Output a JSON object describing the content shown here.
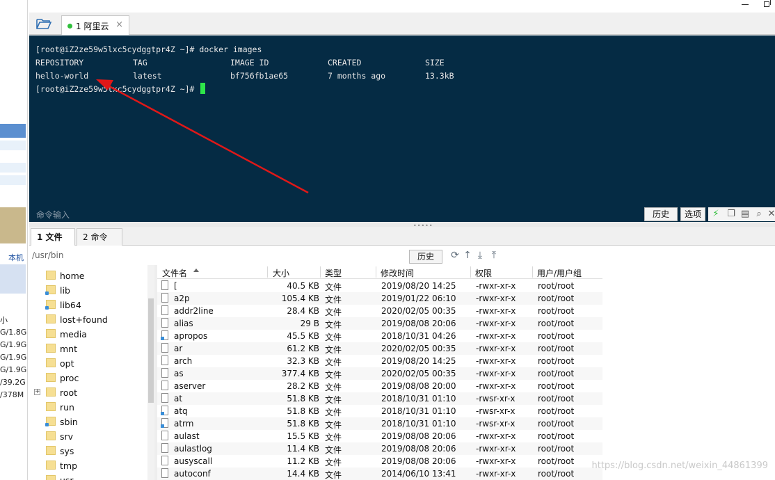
{
  "terminal": {
    "tab_label": "1 阿里云",
    "tab_close": "×",
    "prompt1": "[root@iZ2ze59w5lxc5cydggtpr4Z ~]# docker images",
    "headers": [
      "REPOSITORY",
      "TAG",
      "IMAGE ID",
      "CREATED",
      "SIZE"
    ],
    "row": [
      "hello-world",
      "latest",
      "bf756fb1ae65",
      "7 months ago",
      "13.3kB"
    ],
    "prompt2": "[root@iZ2ze59w5lxc5cydggtpr4Z ~]#",
    "cmd_input_placeholder": "命令输入",
    "history_btn": "历史",
    "options_btn": "选项",
    "cursor_color": "#2ee64a",
    "arrow_color": "#e01818"
  },
  "left_sliver": {
    "local_label": "本机",
    "texts": [
      "小",
      "G/1.8G",
      "G/1.9G",
      "G/1.9G",
      "G/1.9G",
      "/39.2G",
      "/378M"
    ]
  },
  "bottom_tabs": {
    "files": "1 文件",
    "commands": "2 命令"
  },
  "path": {
    "value": "/usr/bin",
    "history_btn": "历史"
  },
  "tree": {
    "items": [
      {
        "label": "home",
        "link": false,
        "expander": ""
      },
      {
        "label": "lib",
        "link": true,
        "expander": ""
      },
      {
        "label": "lib64",
        "link": true,
        "expander": ""
      },
      {
        "label": "lost+found",
        "link": false,
        "expander": ""
      },
      {
        "label": "media",
        "link": false,
        "expander": ""
      },
      {
        "label": "mnt",
        "link": false,
        "expander": ""
      },
      {
        "label": "opt",
        "link": false,
        "expander": ""
      },
      {
        "label": "proc",
        "link": false,
        "expander": ""
      },
      {
        "label": "root",
        "link": false,
        "expander": "+"
      },
      {
        "label": "run",
        "link": false,
        "expander": ""
      },
      {
        "label": "sbin",
        "link": true,
        "expander": ""
      },
      {
        "label": "srv",
        "link": false,
        "expander": ""
      },
      {
        "label": "sys",
        "link": false,
        "expander": ""
      },
      {
        "label": "tmp",
        "link": false,
        "expander": ""
      },
      {
        "label": "usr",
        "link": false,
        "expander": ""
      }
    ]
  },
  "files": {
    "headers": [
      "文件名",
      "大小",
      "类型",
      "修改时间",
      "权限",
      "用户/用户组"
    ],
    "rows": [
      [
        "[",
        "40.5 KB",
        "文件",
        "2019/08/20 14:25",
        "-rwxr-xr-x",
        "root/root",
        false
      ],
      [
        "a2p",
        "105.4 KB",
        "文件",
        "2019/01/22 06:10",
        "-rwxr-xr-x",
        "root/root",
        false
      ],
      [
        "addr2line",
        "28.4 KB",
        "文件",
        "2020/02/05 00:35",
        "-rwxr-xr-x",
        "root/root",
        false
      ],
      [
        "alias",
        "29 B",
        "文件",
        "2019/08/08 20:06",
        "-rwxr-xr-x",
        "root/root",
        false
      ],
      [
        "apropos",
        "45.5 KB",
        "文件",
        "2018/10/31 04:26",
        "-rwxr-xr-x",
        "root/root",
        true
      ],
      [
        "ar",
        "61.2 KB",
        "文件",
        "2020/02/05 00:35",
        "-rwxr-xr-x",
        "root/root",
        false
      ],
      [
        "arch",
        "32.3 KB",
        "文件",
        "2019/08/20 14:25",
        "-rwxr-xr-x",
        "root/root",
        false
      ],
      [
        "as",
        "377.4 KB",
        "文件",
        "2020/02/05 00:35",
        "-rwxr-xr-x",
        "root/root",
        false
      ],
      [
        "aserver",
        "28.2 KB",
        "文件",
        "2019/08/08 20:00",
        "-rwxr-xr-x",
        "root/root",
        false
      ],
      [
        "at",
        "51.8 KB",
        "文件",
        "2018/10/31 01:10",
        "-rwsr-xr-x",
        "root/root",
        false
      ],
      [
        "atq",
        "51.8 KB",
        "文件",
        "2018/10/31 01:10",
        "-rwsr-xr-x",
        "root/root",
        true
      ],
      [
        "atrm",
        "51.8 KB",
        "文件",
        "2018/10/31 01:10",
        "-rwsr-xr-x",
        "root/root",
        true
      ],
      [
        "aulast",
        "15.5 KB",
        "文件",
        "2019/08/08 20:06",
        "-rwxr-xr-x",
        "root/root",
        false
      ],
      [
        "aulastlog",
        "11.4 KB",
        "文件",
        "2019/08/08 20:06",
        "-rwxr-xr-x",
        "root/root",
        false
      ],
      [
        "ausyscall",
        "11.2 KB",
        "文件",
        "2019/08/08 20:06",
        "-rwxr-xr-x",
        "root/root",
        false
      ],
      [
        "autoconf",
        "14.4 KB",
        "文件",
        "2014/06/10 13:41",
        "-rwxr-xr-x",
        "root/root",
        false
      ]
    ]
  },
  "watermark": "https://blog.csdn.net/weixin_44861399"
}
